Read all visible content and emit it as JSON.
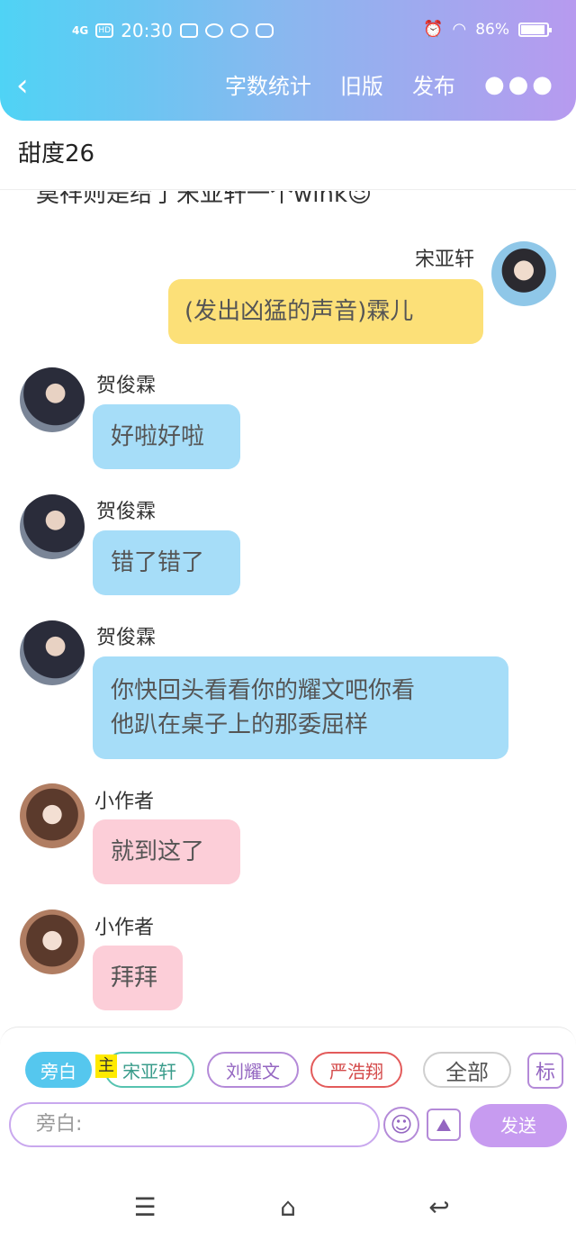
{
  "status_bar": {
    "network": "4G",
    "hd": "HD",
    "time": "20:30",
    "battery": "86%",
    "battery_level": 0.86
  },
  "nav": {
    "back_icon": "chevron-left-icon",
    "word_count": "字数统计",
    "old_version": "旧版",
    "publish": "发布",
    "more_icon": "more-dots-icon",
    "more_glyph": "●●●"
  },
  "doc": {
    "title": "甜度26",
    "partial_line": "莫祥则是给了宋亚轩一个wink😉"
  },
  "messages": [
    {
      "sender": "宋亚轩",
      "text": "(发出凶猛的声音)霖儿",
      "side": "right",
      "color": "yellow"
    },
    {
      "sender": "贺俊霖",
      "text": "好啦好啦",
      "side": "left",
      "color": "blue"
    },
    {
      "sender": "贺俊霖",
      "text": "错了错了",
      "side": "left",
      "color": "blue"
    },
    {
      "sender": "贺俊霖",
      "text_line1": "你快回头看看你的耀文吧你看",
      "text_line2": "他趴在桌子上的那委屈样",
      "side": "left",
      "color": "blue"
    },
    {
      "sender": "小作者",
      "text": "就到这了",
      "side": "left",
      "color": "pink"
    },
    {
      "sender": "小作者",
      "text": "拜拜",
      "side": "left",
      "color": "pink"
    }
  ],
  "composer": {
    "roles": [
      "旁白",
      "宋亚轩",
      "刘耀文",
      "严浩翔",
      "全部"
    ],
    "active_role": "旁白",
    "host_tag": "主",
    "mark_button": "标",
    "input_placeholder": "旁白:",
    "send_label": "发送",
    "emoji_glyph": "☺",
    "image_glyph": "🖼"
  },
  "system_nav": {
    "menu_glyph": "☰",
    "home_glyph": "⌂",
    "back_glyph": "↩"
  }
}
